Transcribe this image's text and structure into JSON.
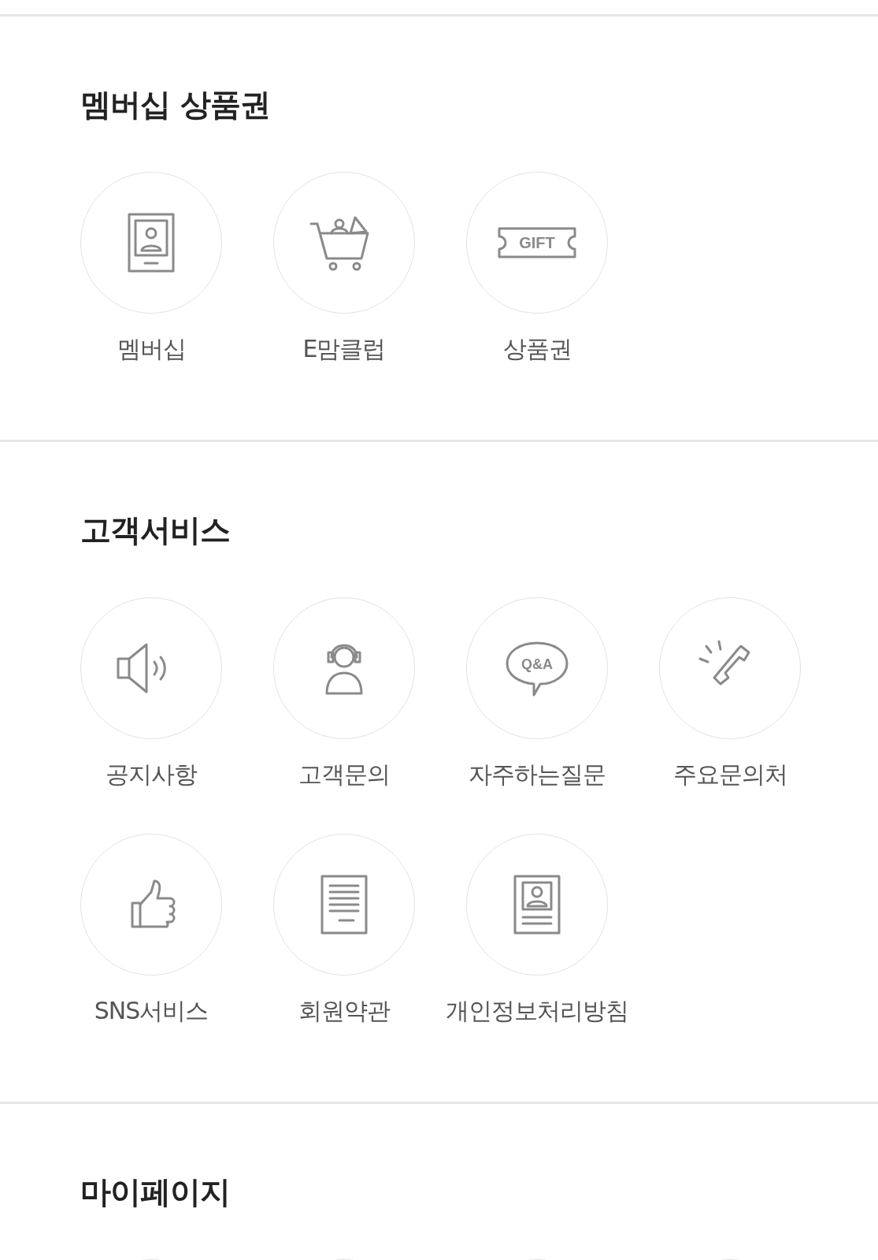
{
  "sections": [
    {
      "title": "멤버십 상품권",
      "items": [
        {
          "kind": "card",
          "label": "멤버십"
        },
        {
          "kind": "cart",
          "label": "E맘클럽"
        },
        {
          "kind": "ticket",
          "icon_text": "GIFT",
          "label": "상품권"
        }
      ]
    },
    {
      "title": "고객서비스",
      "items": [
        {
          "kind": "speaker",
          "label": "공지사항"
        },
        {
          "kind": "headset",
          "label": "고객문의"
        },
        {
          "kind": "bubble",
          "icon_text": "Q&A",
          "label": "자주하는질문"
        },
        {
          "kind": "phone",
          "label": "주요문의처"
        },
        {
          "kind": "thumb",
          "label": "SNS서비스"
        },
        {
          "kind": "document",
          "label": "회원약관"
        },
        {
          "kind": "profile",
          "label": "개인정보처리방침"
        }
      ]
    },
    {
      "title": "마이페이지",
      "items": [
        {
          "kind": "cut"
        },
        {
          "kind": "cut"
        },
        {
          "kind": "cut"
        },
        {
          "kind": "cut"
        }
      ]
    }
  ]
}
